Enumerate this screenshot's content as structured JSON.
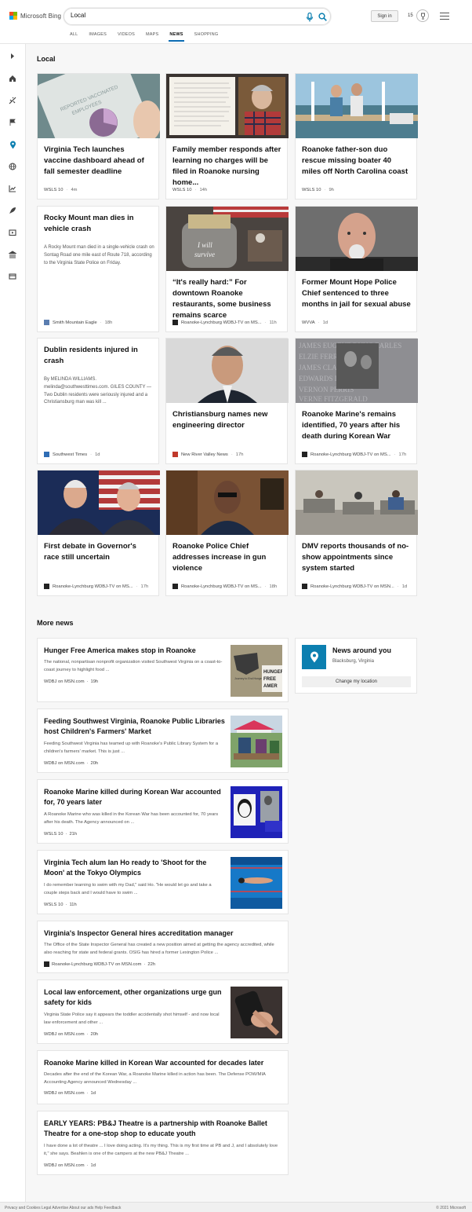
{
  "header": {
    "brand": "Microsoft Bing",
    "search_value": "Local",
    "signin_label": "Sign in",
    "points": "15",
    "tabs": [
      "ALL",
      "IMAGES",
      "VIDEOS",
      "MAPS",
      "NEWS",
      "SHOPPING"
    ],
    "active_tab": "NEWS"
  },
  "local": {
    "title": "Local",
    "cards": [
      {
        "title": "Virginia Tech launches vaccine dashboard ahead of fall semester deadline",
        "source": "WSLS 10",
        "age": "4m"
      },
      {
        "title": "Family member responds after learning no charges will be filed in Roanoke nursing home...",
        "source": "WSLS 10",
        "age": "14h"
      },
      {
        "title": "Roanoke father-son duo rescue missing boater 40 miles off North Carolina coast",
        "source": "WSLS 10",
        "age": "9h"
      },
      {
        "title": "Rocky Mount man dies in vehicle crash",
        "snippet": "A Rocky Mount man died in a single-vehicle crash on Sontag Road one mile east of Route 718, according to the Virginia State Police on Friday.",
        "source": "Smith Mountain Eagle",
        "age": "18h"
      },
      {
        "title": "“It's really hard:” For downtown Roanoke restaurants, some business remains scarce",
        "source": "Roanoke-Lynchburg WDBJ-TV on MS...",
        "age": "11h"
      },
      {
        "title": "Former Mount Hope Police Chief sentenced to three months in jail for sexual abuse",
        "source": "WVVA",
        "age": "1d"
      },
      {
        "title": "Dublin residents injured in crash",
        "snippet": "By MELINDA WILLIAMS. melinda@southwesttimes.com. GILES COUNTY — Two Dublin residents were seriously injured and a Christiansburg man was kill ...",
        "source": "Southwest Times",
        "age": "1d"
      },
      {
        "title": "Christiansburg names new engineering director",
        "source": "New River Valley News",
        "age": "17h"
      },
      {
        "title": "Roanoke Marine's remains identified, 70 years after his death during Korean War",
        "source": "Roanoke-Lynchburg WDBJ-TV on MS...",
        "age": "17h"
      },
      {
        "title": "First debate in Governor's race still uncertain",
        "source": "Roanoke-Lynchburg WDBJ-TV on MS...",
        "age": "17h"
      },
      {
        "title": "Roanoke Police Chief addresses increase in gun violence",
        "source": "Roanoke-Lynchburg WDBJ-TV on MS...",
        "age": "18h"
      },
      {
        "title": "DMV reports thousands of no-show appointments since system started",
        "source": "Roanoke-Lynchburg WDBJ-TV on MSN...",
        "age": "1d"
      }
    ]
  },
  "more_news": {
    "title": "More news",
    "items": [
      {
        "title": "Hunger Free America makes stop in Roanoke",
        "snippet": "The national, nonpartisan nonprofit organization visited Southwest Virginia on a coast-to-coast journey to highlight food ...",
        "source": "WDBJ on MSN.com",
        "age": "19h"
      },
      {
        "title": "Feeding Southwest Virginia, Roanoke Public Libraries host Children's Farmers' Market",
        "snippet": "Feeding Southwest Virginia has teamed up with Roanoke's Public Library System for a children's farmers' market. This is just ...",
        "source": "WDBJ on MSN.com",
        "age": "20h"
      },
      {
        "title": "Roanoke Marine killed during Korean War accounted for, 70 years later",
        "snippet": "A Roanoke Marine who was killed in the Korean War has been accounted for, 70 years after his death. The Agency announced on ...",
        "source": "WSLS 10",
        "age": "21h"
      },
      {
        "title": "Virginia Tech alum Ian Ho ready to 'Shoot for the Moon' at the Tokyo Olympics",
        "snippet": "I do remember learning to swim with my Dad,\" said Ho. \"He would let go and take a couple steps back and I would have to swim ...",
        "source": "WSLS 10",
        "age": "11h"
      },
      {
        "title": "Virginia's Inspector General hires accreditation manager",
        "snippet": "The Office of the State Inspector General has created a new position aimed at getting the agency accredited, while also reaching for state and federal grants. OSIG has hired a former Lexington Police ...",
        "source": "Roanoke-Lynchburg WDBJ-TV on MSN.com",
        "age": "22h"
      },
      {
        "title": "Local law enforcement, other organizations urge gun safety for kids",
        "snippet": "Virginia State Police say it appears the toddler accidentally shot himself - and now local law enforcement and other ...",
        "source": "WDBJ on MSN.com",
        "age": "20h"
      },
      {
        "title": "Roanoke Marine killed in Korean War accounted for decades later",
        "snippet": "Decades after the end of the Korean War, a Roanoke Marine killed in action has been. The Defense POW/MIA Accounting Agency announced Wednesday ...",
        "source": "WDBJ on MSN.com",
        "age": "1d"
      },
      {
        "title": "EARLY YEARS: PB&J Theatre is a partnership with Roanoke Ballet Theatre for a one-stop shop to educate youth",
        "snippet": "I have done a lot of theatre ... I love doing acting. It's my thing. This is my first time at PB and J, and I absolutely love it,\" she says. Beahlen is one of the campers at the new PB&J Theatre ...",
        "source": "WDBJ on MSN.com",
        "age": "1d"
      }
    ],
    "hunger_thumb_text": "HUNGER FREE AMER",
    "hunger_thumb_small": "Journey to End Hunger Summer 2021"
  },
  "around": {
    "title": "News around you",
    "location": "Blacksburg, Virginia",
    "button": "Change my location"
  },
  "footer": {
    "links": "Privacy and Cookies   Legal   Advertise   About our ads   Help   Feedback",
    "copy": "© 2021 Microsoft"
  },
  "colors": {
    "accent": "#0c6cb3",
    "pin_bg": "#0c7fb0"
  }
}
